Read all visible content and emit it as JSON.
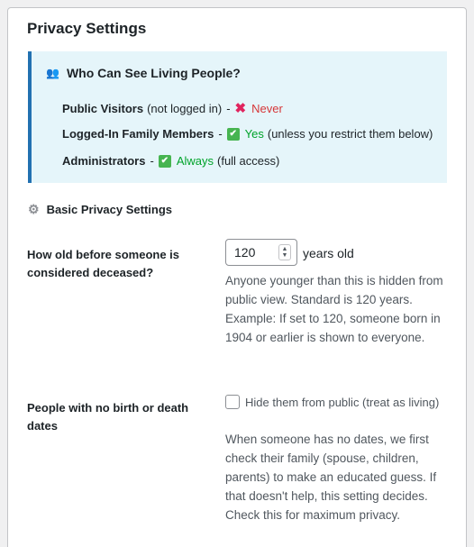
{
  "panel": {
    "title": "Privacy Settings"
  },
  "info": {
    "heading": "Who Can See Living People?",
    "lines": [
      {
        "label": "Public Visitors",
        "qualifier": "(not logged in)",
        "status": "Never",
        "extra": ""
      },
      {
        "label": "Logged-In Family Members",
        "qualifier": "",
        "status": "Yes",
        "extra": "(unless you restrict them below)"
      },
      {
        "label": "Administrators",
        "qualifier": "",
        "status": "Always",
        "extra": "(full access)"
      }
    ]
  },
  "basic": {
    "heading": "Basic Privacy Settings"
  },
  "deceased": {
    "label": "How old before someone is considered deceased?",
    "value": "120",
    "unit": "years old",
    "description": "Anyone younger than this is hidden from public view. Standard is 120 years. Example: If set to 120, someone born in 1904 or earlier is shown to everyone."
  },
  "no_dates": {
    "label": "People with no birth or death dates",
    "checkbox_label": "Hide them from public (treat as living)",
    "checked": false,
    "description": "When someone has no dates, we first check their family (spouse, children, parents) to make an educated guess. If that doesn't help, this setting decides. Check this for maximum privacy."
  },
  "icons": {
    "people": "people-icon",
    "cross": "cross-mark-icon",
    "check": "check-mark-icon",
    "gear": "gear-icon"
  },
  "colors": {
    "accent": "#2271b1",
    "info_bg": "#e5f5fa",
    "never": "#d63638",
    "yes": "#00a32a"
  }
}
